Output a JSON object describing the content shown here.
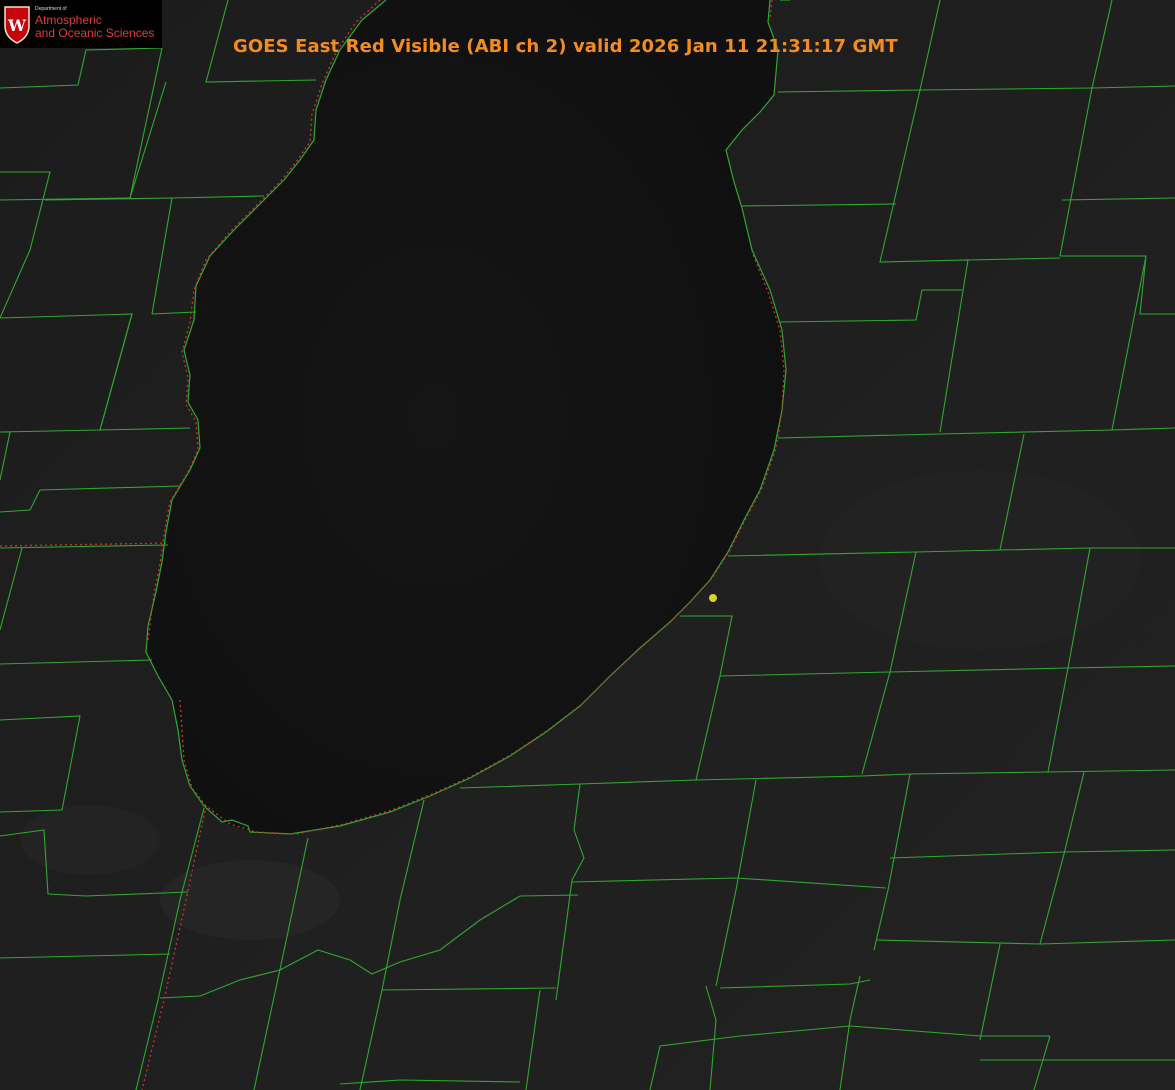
{
  "header": {
    "title": "GOES East Red Visible (ABI ch 2) valid 2026 Jan 11 21:31:17 GMT"
  },
  "logo": {
    "department": "Department of",
    "line1": "Atmospheric",
    "line2": "and Oceanic Sciences",
    "emblem_letter": "W"
  },
  "map": {
    "county_border_color": "#2fa82f",
    "shoreline_color": "#2fa82f",
    "state_border_color": "#c8372d",
    "station_marker_color": "#d6d22c",
    "background_color": "#1b1b1b",
    "lake_color": "#121212"
  }
}
